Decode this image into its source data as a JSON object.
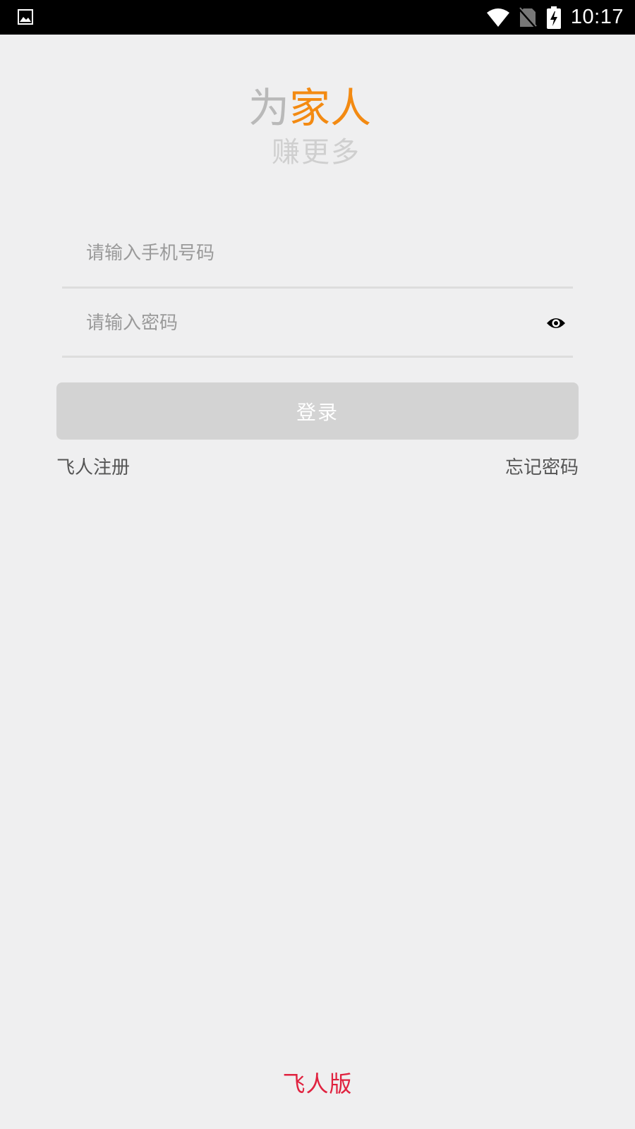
{
  "status_bar": {
    "time": "10:17",
    "icons": [
      "gallery-icon",
      "wifi-icon",
      "no-sim-icon",
      "battery-charging-icon"
    ]
  },
  "logo": {
    "line1_part1": "为",
    "line1_part2": "家人",
    "line2": "赚更多",
    "colors": {
      "gray": "#b9b9b9",
      "orange": "#f38a12",
      "light_gray": "#cfcfcf"
    }
  },
  "form": {
    "phone": {
      "value": "",
      "placeholder": "请输入手机号码"
    },
    "password": {
      "value": "",
      "placeholder": "请输入密码",
      "toggle_icon": "eye-icon"
    },
    "login_label": "登录",
    "login_color": "#d3d3d3"
  },
  "links": {
    "register": "飞人注册",
    "forgot": "忘记密码"
  },
  "footer": {
    "label": "飞人版",
    "color": "#e0223f"
  }
}
